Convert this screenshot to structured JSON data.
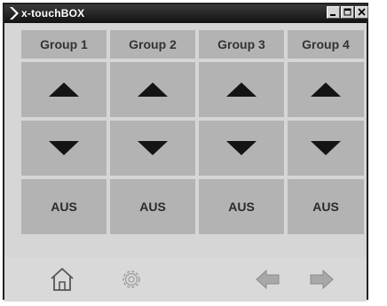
{
  "window": {
    "title": "x-touchBOX"
  },
  "groups": [
    {
      "label": "Group 1",
      "up_icon": "arrow-up-icon",
      "down_icon": "arrow-down-icon",
      "off_label": "AUS"
    },
    {
      "label": "Group 2",
      "up_icon": "arrow-up-icon",
      "down_icon": "arrow-down-icon",
      "off_label": "AUS"
    },
    {
      "label": "Group 3",
      "up_icon": "arrow-up-icon",
      "down_icon": "arrow-down-icon",
      "off_label": "AUS"
    },
    {
      "label": "Group 4",
      "up_icon": "arrow-up-icon",
      "down_icon": "arrow-down-icon",
      "off_label": "AUS"
    }
  ],
  "footer": {
    "icons": [
      "home-icon",
      "gear-icon",
      "back-arrow-icon",
      "forward-arrow-icon"
    ]
  },
  "colors": {
    "titlebar": "#1a1a1a",
    "cell": "#b3b3b3",
    "background": "#d6d6d6",
    "arrow": "#141414"
  }
}
